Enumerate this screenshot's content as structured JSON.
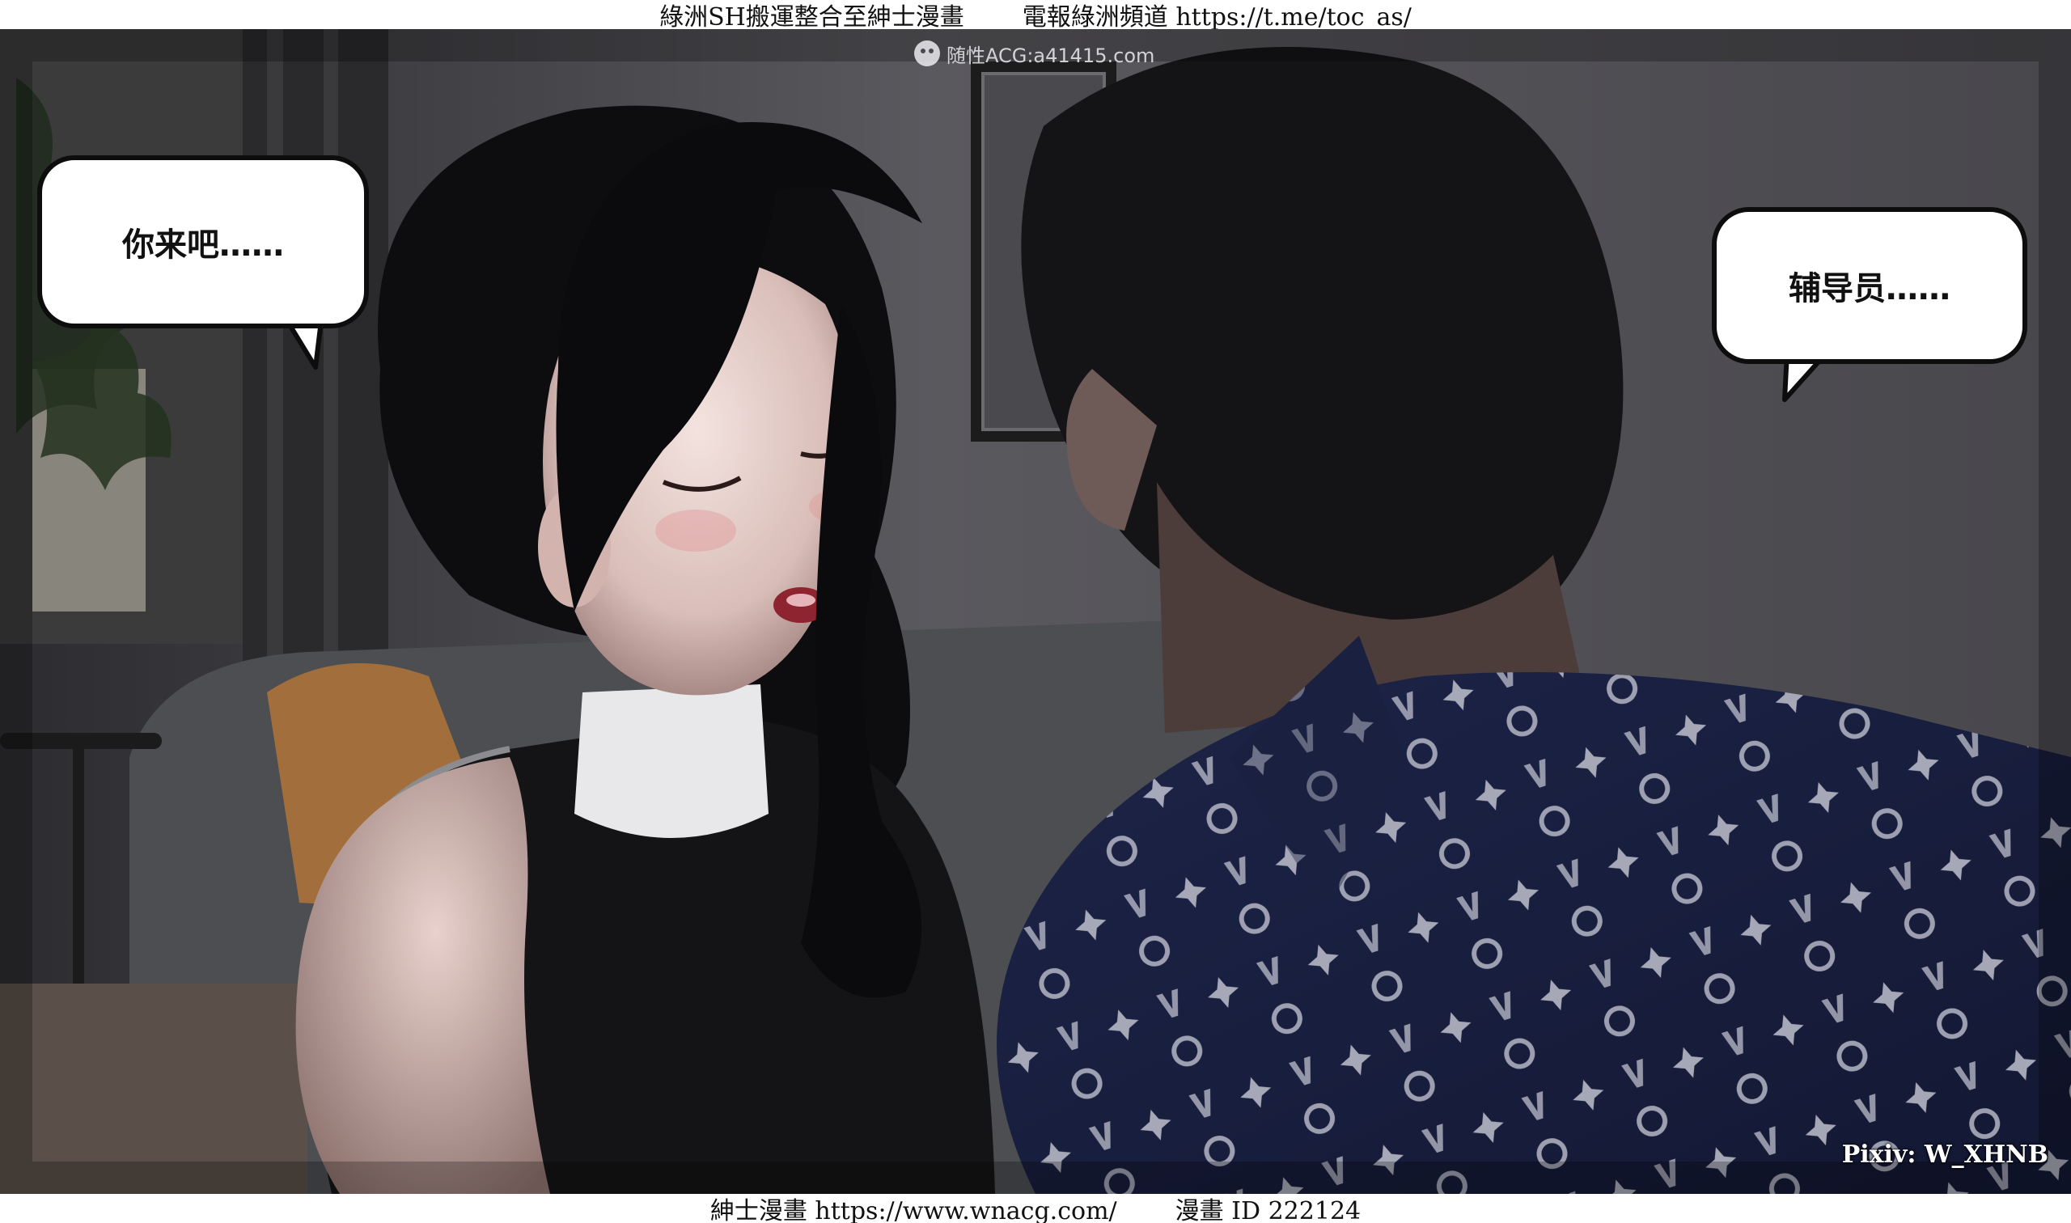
{
  "header": {
    "left_text": "綠洲SH搬運整合至紳士漫畫",
    "right_text": "電報綠洲頻道 https://t.me/toc_as/"
  },
  "scene": {
    "watermark": "随性ACG:a41415.com",
    "bubbles": [
      {
        "speaker": "girl",
        "text": "你来吧……"
      },
      {
        "speaker": "boy",
        "text": "辅导员……"
      }
    ],
    "credit": "Pixiv: W_XHNB"
  },
  "footer": {
    "left_text": "紳士漫畫 https://www.wnacg.com/",
    "right_text": "漫畫 ID 222124"
  }
}
